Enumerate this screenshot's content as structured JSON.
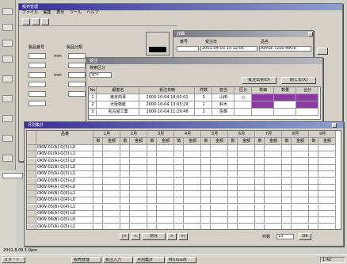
{
  "desktop": {
    "status_left": "2001.8.09 1:0pm",
    "tray_time": "1:42"
  },
  "window_main": {
    "title": "販売管理",
    "menu": [
      "ファイル",
      "編集",
      "表示",
      "ツール",
      "ヘルプ"
    ],
    "labels": [
      "製品番号",
      "製品分類"
    ],
    "unit": "mm"
  },
  "window_detail": {
    "title": "詳細",
    "labels": [
      "番号",
      "受注日",
      "品名"
    ],
    "values": [
      "2001-04-03 10:12:05",
      "APPLE 7200 MATE"
    ]
  },
  "window_orders": {
    "title": "受注",
    "filter_label": "検索区分",
    "filter_value": "全件",
    "button1": "受注伝票(D)",
    "button2": "閉じる(X)",
    "columns": [
      "No",
      "顧客名",
      "受注日時",
      "件数",
      "担当",
      "区分",
      "単価",
      "数量",
      "合計"
    ],
    "rows": [
      [
        "1",
        "東京商事",
        "2000-10-04 18:00:01",
        "3",
        "山田",
        "○",
        "",
        "",
        ""
      ],
      [
        "2",
        "大阪物産",
        "2000-10-04 13:05:29",
        "1",
        "鈴木",
        "",
        "",
        "",
        ""
      ],
      [
        "3",
        "名古屋工業",
        "2000-10-04 11:29:48",
        "2",
        "佐藤",
        "",
        "",
        "",
        ""
      ]
    ]
  },
  "window_grid": {
    "title": "月別集計",
    "first_col_header": "品番",
    "group_headers": [
      "1月",
      "2月",
      "3月",
      "4月",
      "5月",
      "6月",
      "7月",
      "8月",
      "9月"
    ],
    "sub_headers": [
      "数",
      "金額"
    ],
    "rows": [
      "OKW-01(A)-Q(3)-L0",
      "OKW-01(A)-Q(3)-L1",
      "OKW-02(A)-Q(3)-L0",
      "OKW-02(B)-Q(3)-L0",
      "OKW-03(A)-Q(3)-L1",
      "OKW-03(B)-Q(3)-L0",
      "OKW-04(A)-Q(4)-L0",
      "OKW-04(B)-Q(4)-L1",
      "OKW-05(A)-Q(4)-L0",
      "OKW-05(B)-Q(4)-L1",
      "OKW-06(A)-Q(4)-L0",
      "OKW-06(B)-Q(5)-L0",
      "OKW-07(A)-Q(5)-L1"
    ],
    "nav_buttons": [
      "|<",
      "<",
      "前月",
      ">",
      ">|"
    ],
    "count_label": "件数",
    "count_value": "13",
    "ok_button": "OK"
  },
  "taskbar": {
    "start": "スタート",
    "tasks": [
      "販売管理",
      "受注入力",
      "月別集計",
      "Microsoft"
    ]
  },
  "colors": {
    "title_active": "#3a2f97",
    "highlight": "#8a3aa2"
  }
}
